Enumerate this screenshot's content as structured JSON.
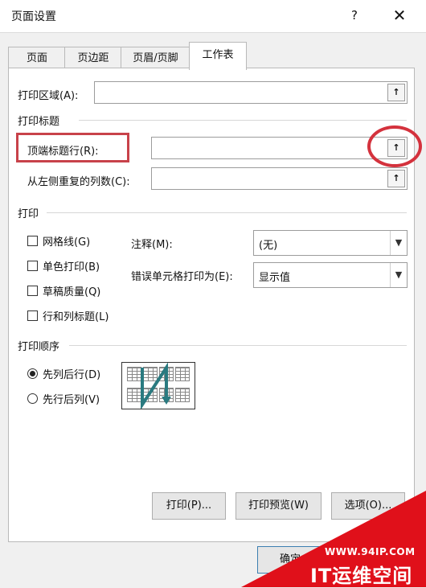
{
  "window": {
    "title": "页面设置",
    "help_label": "?",
    "close_label": "✕"
  },
  "tabs": [
    {
      "label": "页面"
    },
    {
      "label": "页边距"
    },
    {
      "label": "页眉/页脚"
    },
    {
      "label": "工作表"
    }
  ],
  "active_tab": "工作表",
  "print_area": {
    "label": "打印区域(A):",
    "value": ""
  },
  "print_titles": {
    "section": "打印标题",
    "rows": {
      "label": "顶端标题行(R):",
      "value": ""
    },
    "cols": {
      "label": "从左侧重复的列数(C):",
      "value": ""
    }
  },
  "print_section": {
    "section": "打印",
    "checkboxes": [
      {
        "label": "网格线(G)",
        "checked": false
      },
      {
        "label": "单色打印(B)",
        "checked": false
      },
      {
        "label": "草稿质量(Q)",
        "checked": false
      },
      {
        "label": "行和列标题(L)",
        "checked": false
      }
    ],
    "comments": {
      "label": "注释(M):",
      "value": "(无)"
    },
    "errors": {
      "label": "错误单元格打印为(E):",
      "value": "显示值"
    }
  },
  "page_order": {
    "section": "打印顺序",
    "options": [
      {
        "label": "先列后行(D)",
        "selected": true
      },
      {
        "label": "先行后列(V)",
        "selected": false
      }
    ]
  },
  "buttons": {
    "print": "打印(P)...",
    "preview": "打印预览(W)",
    "options": "选项(O)...",
    "ok": "确定"
  },
  "collapse_icon": "↑",
  "watermark": {
    "url": "WWW.94IP.COM",
    "name": "IT运维空间"
  },
  "colors": {
    "highlight": "#d4323d",
    "watermark": "#e0101a",
    "arrow": "#2a7a80"
  }
}
